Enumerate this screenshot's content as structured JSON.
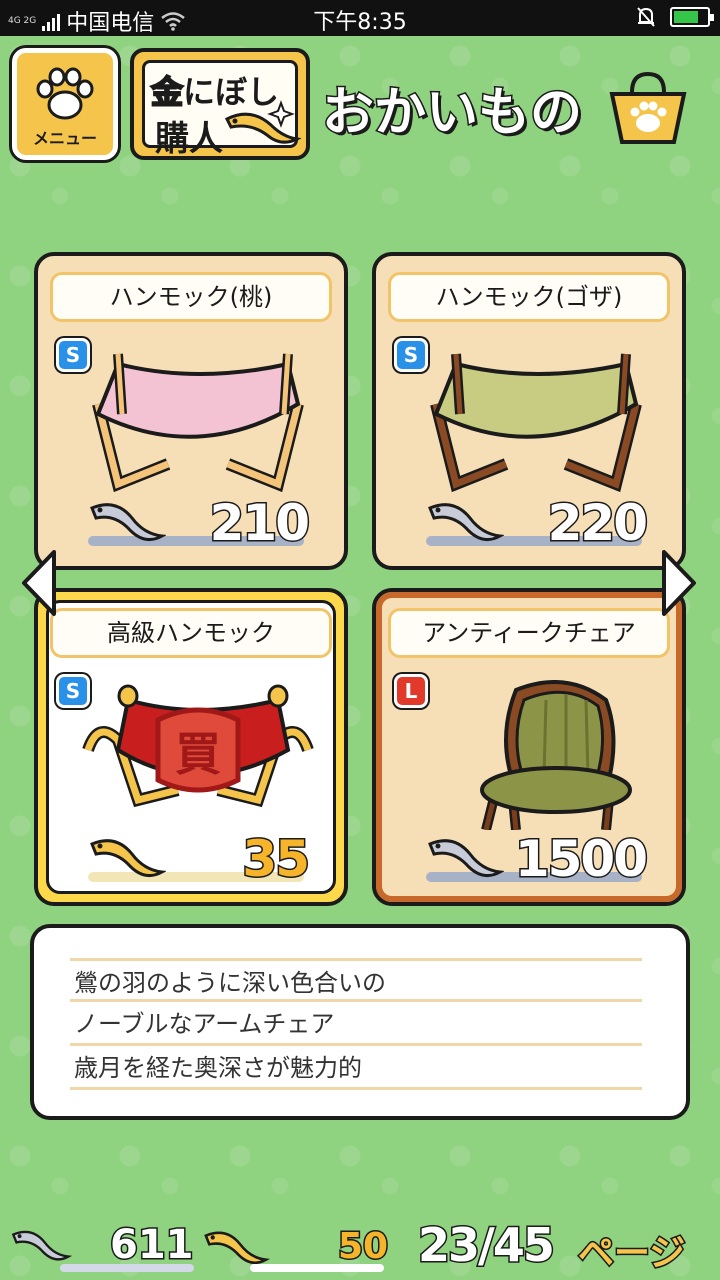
{
  "statusbar": {
    "carrier": "中国电信",
    "network": "4G 2G",
    "time": "下午8:35"
  },
  "header": {
    "menu_label": "メニュー",
    "buy_line1": "にぼし",
    "buy_line2": "購人",
    "buy_kanji": "金",
    "title": "おかいもの"
  },
  "items": [
    {
      "name": "ハンモック(桃)",
      "size": "S",
      "price": "210",
      "price_currency": "silver"
    },
    {
      "name": "ハンモック(ゴザ)",
      "size": "S",
      "price": "220",
      "price_currency": "silver"
    },
    {
      "name": "高級ハンモック",
      "size": "S",
      "price": "35",
      "price_currency": "gold",
      "stamp": "買"
    },
    {
      "name": "アンティークチェア",
      "size": "L",
      "price": "1500",
      "price_currency": "silver"
    }
  ],
  "description": [
    "鶯の羽のように深い色合いの",
    "ノーブルなアームチェア",
    "歳月を経た奥深さが魅力的"
  ],
  "footer": {
    "silver_count": "611",
    "gold_count": "50",
    "page": "23/45",
    "page_label": "ページ"
  },
  "colors": {
    "background": "#8fd27f",
    "card": "#f6dfb7",
    "gold": "#f5b42a",
    "selected_border": "#c8692b"
  }
}
